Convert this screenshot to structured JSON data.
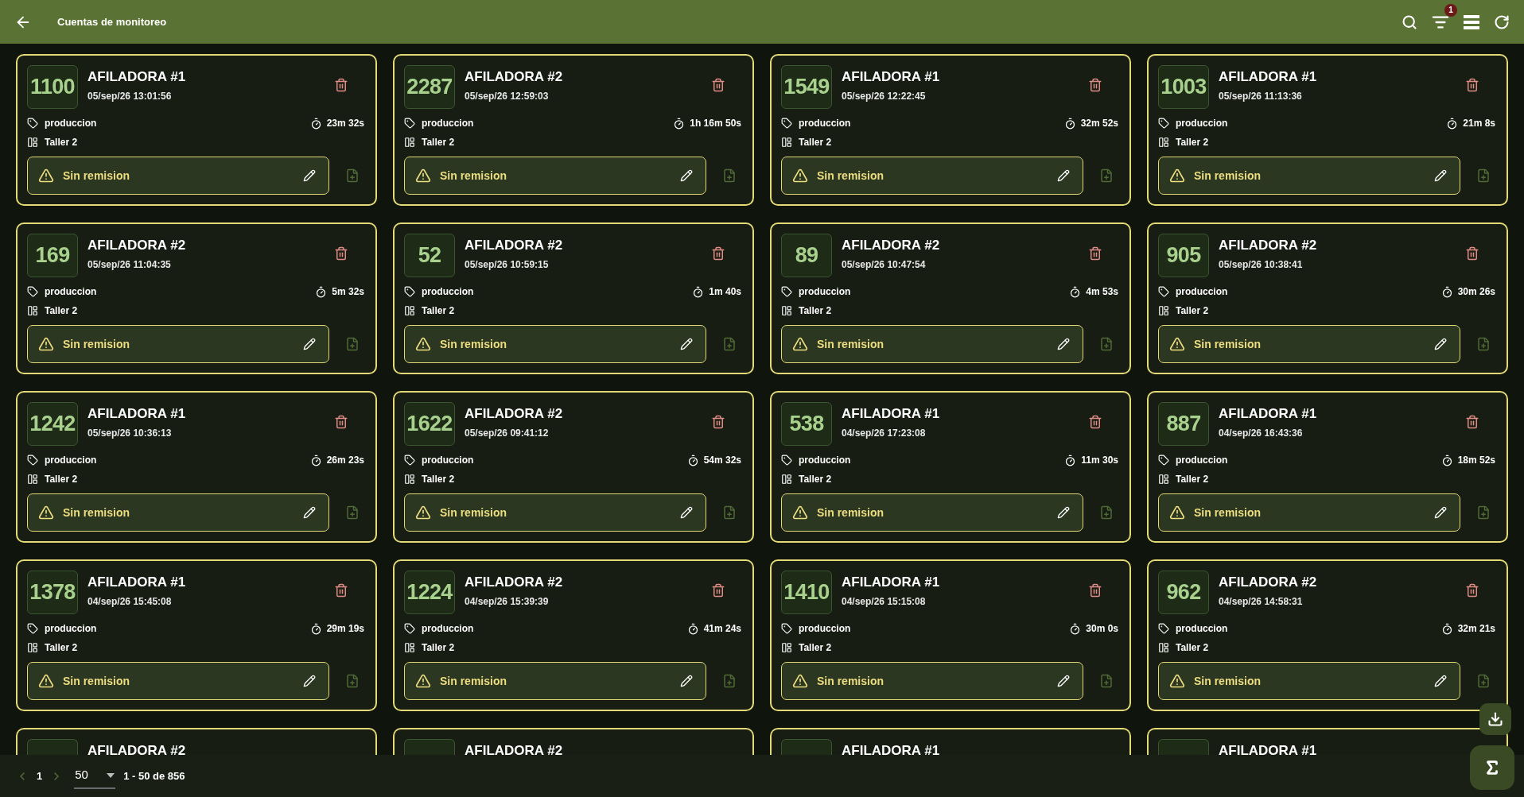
{
  "app_bar": {
    "title": "Cuentas de monitoreo",
    "filter_badge": "1"
  },
  "cards": [
    {
      "number": "1100",
      "machine": "AFILADORA #1",
      "datetime": "05/sep/26 13:01:56",
      "category": "produccion",
      "duration": "23m 32s",
      "location": "Taller 2",
      "status": "Sin remision"
    },
    {
      "number": "2287",
      "machine": "AFILADORA #2",
      "datetime": "05/sep/26 12:59:03",
      "category": "produccion",
      "duration": "1h 16m 50s",
      "location": "Taller 2",
      "status": "Sin remision"
    },
    {
      "number": "1549",
      "machine": "AFILADORA #1",
      "datetime": "05/sep/26 12:22:45",
      "category": "produccion",
      "duration": "32m 52s",
      "location": "Taller 2",
      "status": "Sin remision"
    },
    {
      "number": "1003",
      "machine": "AFILADORA #1",
      "datetime": "05/sep/26 11:13:36",
      "category": "produccion",
      "duration": "21m 8s",
      "location": "Taller 2",
      "status": "Sin remision"
    },
    {
      "number": "169",
      "machine": "AFILADORA #2",
      "datetime": "05/sep/26 11:04:35",
      "category": "produccion",
      "duration": "5m 32s",
      "location": "Taller 2",
      "status": "Sin remision"
    },
    {
      "number": "52",
      "machine": "AFILADORA #2",
      "datetime": "05/sep/26 10:59:15",
      "category": "produccion",
      "duration": "1m 40s",
      "location": "Taller 2",
      "status": "Sin remision"
    },
    {
      "number": "89",
      "machine": "AFILADORA #2",
      "datetime": "05/sep/26 10:47:54",
      "category": "produccion",
      "duration": "4m 53s",
      "location": "Taller 2",
      "status": "Sin remision"
    },
    {
      "number": "905",
      "machine": "AFILADORA #2",
      "datetime": "05/sep/26 10:38:41",
      "category": "produccion",
      "duration": "30m 26s",
      "location": "Taller 2",
      "status": "Sin remision"
    },
    {
      "number": "1242",
      "machine": "AFILADORA #1",
      "datetime": "05/sep/26 10:36:13",
      "category": "produccion",
      "duration": "26m 23s",
      "location": "Taller 2",
      "status": "Sin remision"
    },
    {
      "number": "1622",
      "machine": "AFILADORA #2",
      "datetime": "05/sep/26 09:41:12",
      "category": "produccion",
      "duration": "54m 32s",
      "location": "Taller 2",
      "status": "Sin remision"
    },
    {
      "number": "538",
      "machine": "AFILADORA #1",
      "datetime": "04/sep/26 17:23:08",
      "category": "produccion",
      "duration": "11m 30s",
      "location": "Taller 2",
      "status": "Sin remision"
    },
    {
      "number": "887",
      "machine": "AFILADORA #1",
      "datetime": "04/sep/26 16:43:36",
      "category": "produccion",
      "duration": "18m 52s",
      "location": "Taller 2",
      "status": "Sin remision"
    },
    {
      "number": "1378",
      "machine": "AFILADORA #1",
      "datetime": "04/sep/26 15:45:08",
      "category": "produccion",
      "duration": "29m 19s",
      "location": "Taller 2",
      "status": "Sin remision"
    },
    {
      "number": "1224",
      "machine": "AFILADORA #2",
      "datetime": "04/sep/26 15:39:39",
      "category": "produccion",
      "duration": "41m 24s",
      "location": "Taller 2",
      "status": "Sin remision"
    },
    {
      "number": "1410",
      "machine": "AFILADORA #1",
      "datetime": "04/sep/26 15:15:08",
      "category": "produccion",
      "duration": "30m 0s",
      "location": "Taller 2",
      "status": "Sin remision"
    },
    {
      "number": "962",
      "machine": "AFILADORA #2",
      "datetime": "04/sep/26 14:58:31",
      "category": "produccion",
      "duration": "32m 21s",
      "location": "Taller 2",
      "status": "Sin remision"
    }
  ],
  "partial_cards": [
    {
      "machine": "AFILADORA #2"
    },
    {
      "machine": "AFILADORA #2"
    },
    {
      "machine": "AFILADORA #1"
    },
    {
      "machine": "AFILADORA #1"
    }
  ],
  "pagination": {
    "page": "1",
    "per_page": "50",
    "range": "1 - 50 de 856"
  }
}
